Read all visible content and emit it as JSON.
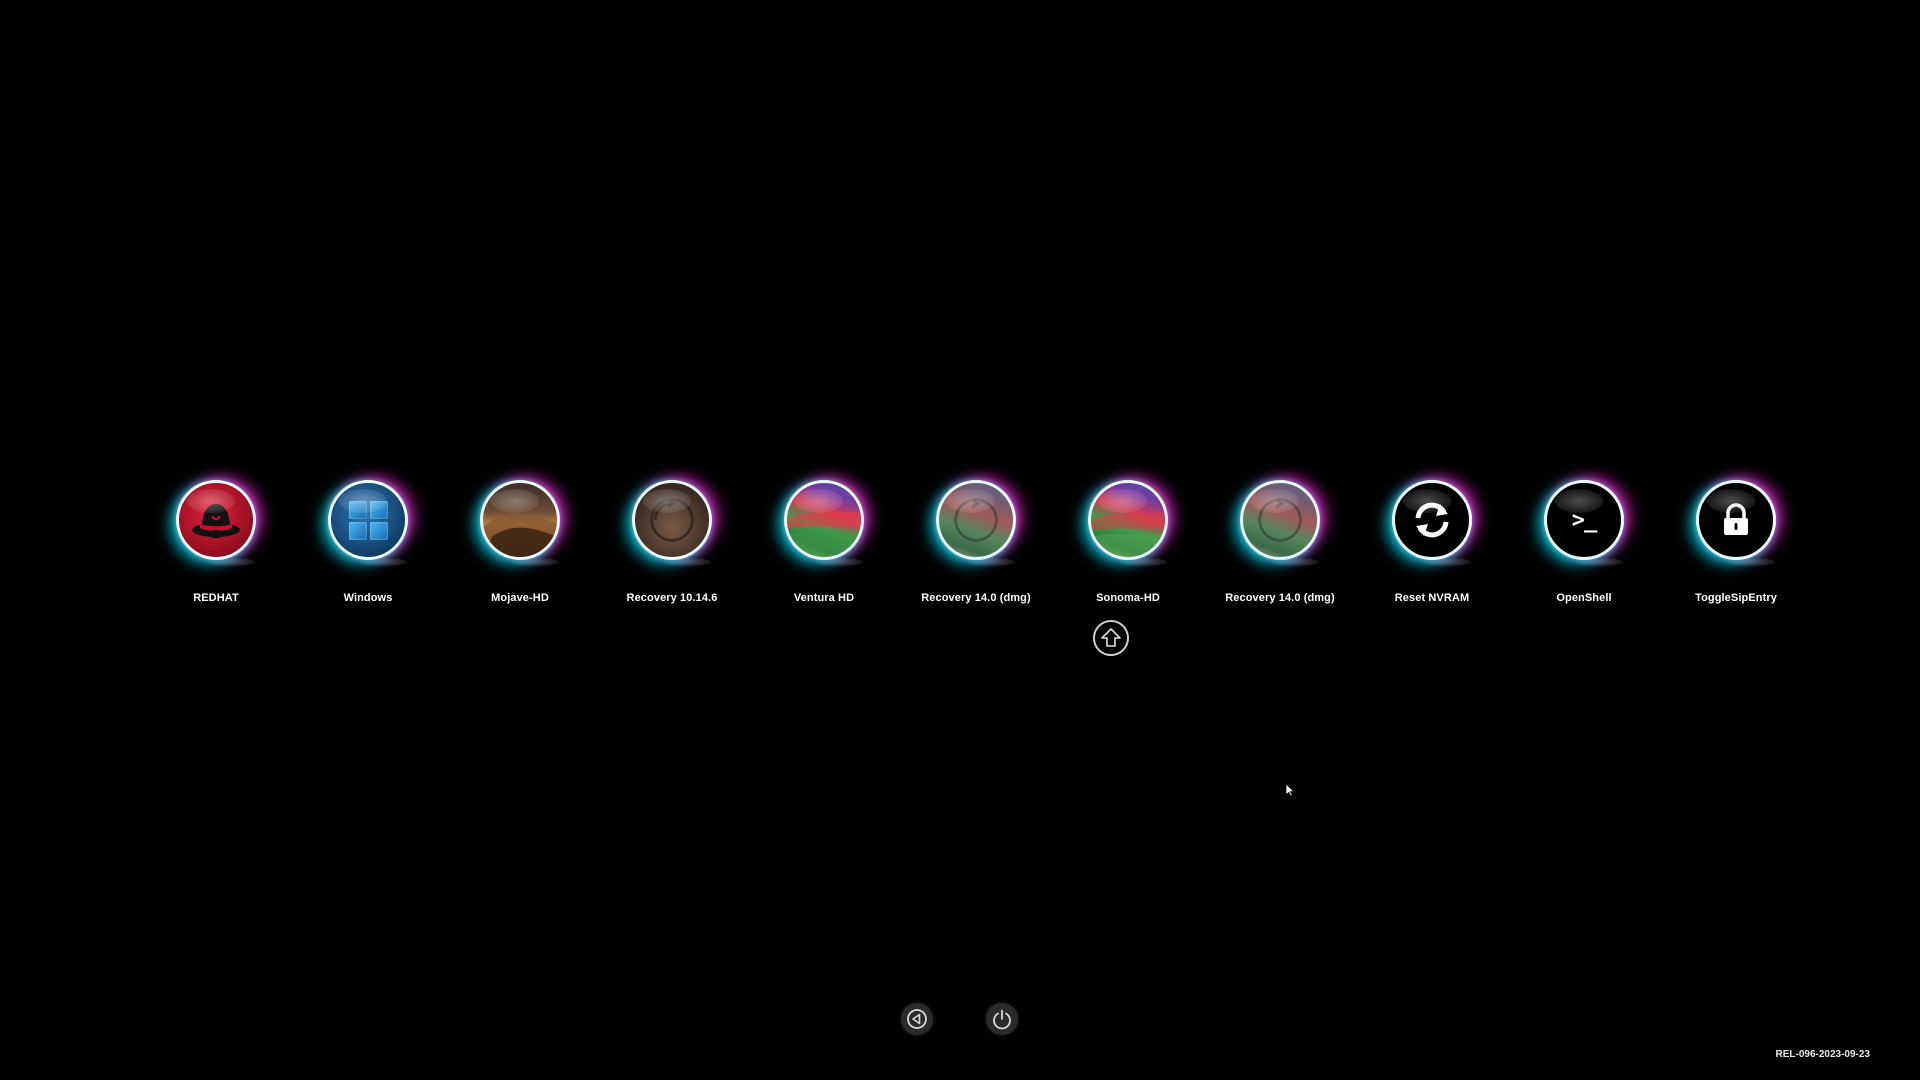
{
  "entries": [
    {
      "label": "REDHAT",
      "icon": "redhat-icon"
    },
    {
      "label": "Windows",
      "icon": "windows-icon"
    },
    {
      "label": "Mojave-HD",
      "icon": "mojave-disk-icon"
    },
    {
      "label": "Recovery 10.14.6",
      "icon": "mojave-recovery-icon"
    },
    {
      "label": "Ventura HD",
      "icon": "ventura-disk-icon"
    },
    {
      "label": "Recovery 14.0 (dmg)",
      "icon": "sonoma-recovery-icon"
    },
    {
      "label": "Sonoma-HD",
      "icon": "sonoma-disk-icon",
      "selected": true
    },
    {
      "label": "Recovery 14.0 (dmg)",
      "icon": "sonoma-recovery-icon"
    },
    {
      "label": "Reset NVRAM",
      "icon": "refresh-icon"
    },
    {
      "label": "OpenShell",
      "icon": "terminal-icon"
    },
    {
      "label": "ToggleSipEntry",
      "icon": "lock-icon"
    }
  ],
  "selection_indicator": {
    "icon": "up-arrow-icon"
  },
  "bottom_buttons": {
    "back_icon": "back-arrow-icon",
    "shutdown_icon": "power-icon"
  },
  "footer": {
    "version": "REL-096-2023-09-23"
  },
  "colors": {
    "background": "#000000",
    "glow_cyan": "#00e6ff",
    "glow_magenta": "#ff28dc"
  }
}
